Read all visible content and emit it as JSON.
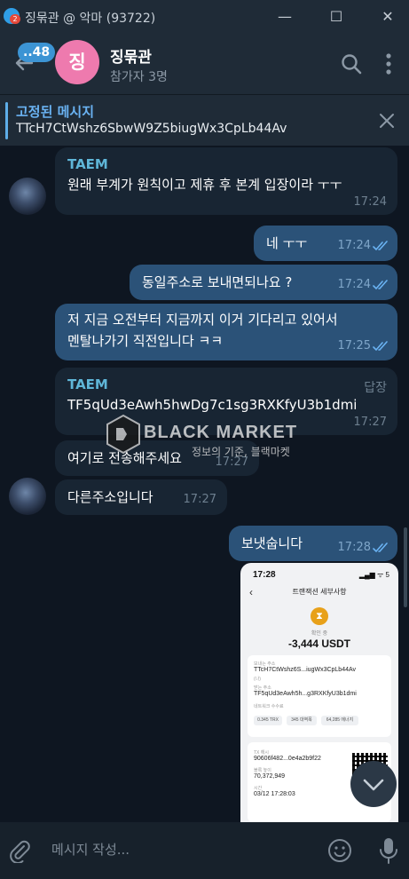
{
  "window": {
    "title": "징묶관 @ 악마 (93722)",
    "app_badge": "2",
    "minimize": "—",
    "maximize": "☐",
    "close": "✕"
  },
  "header": {
    "unread_count": "..48",
    "avatar_letter": "징",
    "avatar_color": "#ee7aae",
    "chat_name": "징묶관",
    "members": "참가자 3명"
  },
  "pinned": {
    "title": "고정된 메시지",
    "text": "TTcH7CtWshz6SbwW9Z5biugWx3CpLb44Av"
  },
  "messages": [
    {
      "dir": "in",
      "sender": "TAEM",
      "text": "원래 부계가 원칙이고 제휴 후 본계 입장이라 ㅜㅜ",
      "time": "17:24"
    },
    {
      "dir": "out",
      "text": "네 ㅜㅜ",
      "time": "17:24"
    },
    {
      "dir": "out",
      "text": "동일주소로 보내면되나요 ?",
      "time": "17:24"
    },
    {
      "dir": "out",
      "lines": [
        "저 지금 오전부터 지금까지 이거 기다리고 있어서",
        "멘탈나가기 직전입니다 ㅋㅋ"
      ],
      "time": "17:25"
    },
    {
      "dir": "in",
      "sender": "TAEM",
      "reply_tag": "답장",
      "text": "TF5qUd3eAwh5hwDg7c1sg3RXKfyU3b1dmi",
      "time": "17:27"
    },
    {
      "dir": "in",
      "text": "여기로 전송해주세요",
      "time": "17:27"
    },
    {
      "dir": "in",
      "text": "다른주소입니다",
      "time": "17:27"
    },
    {
      "dir": "out",
      "text": "보냇숩니다",
      "time": "17:28"
    }
  ],
  "receipt": {
    "status_time": "17:28",
    "status_icons": "▂▄▆ ᯤ 5",
    "back": "‹",
    "title": "트랜잭션 세부사항",
    "state": "확인 중",
    "amount": "-3,444 USDT",
    "from_label": "보내는 주소",
    "from_value": "TTcH7CtWshz6S...iugWx3CpLb44Av",
    "from_sub": "(나)",
    "to_label": "받는 주소",
    "to_value": "TF5qUd3eAwh5h...g3RXKfyU3b1dmi",
    "fee_label": "네트워크 수수료",
    "fee_chips": [
      "0.345 TRX",
      "345 대역폭",
      "64,285 에너지"
    ],
    "hash_label": "TX 해시",
    "hash_value": "90606f482...0e4a2b9f22",
    "block_label": "블록 높이",
    "block_value": "70,372,949",
    "time_label": "시간",
    "time_value": "03/12 17:28:03"
  },
  "watermark": {
    "text": "BLACK MARKET",
    "sub": "정보의 기준, 블랙마켓"
  },
  "composer": {
    "placeholder": "메시지 작성..."
  },
  "colors": {
    "incoming_bubble": "#182533",
    "outgoing_bubble": "#2b5278",
    "sender_name": "#5fb6d8",
    "accent": "#6ab3f3"
  }
}
